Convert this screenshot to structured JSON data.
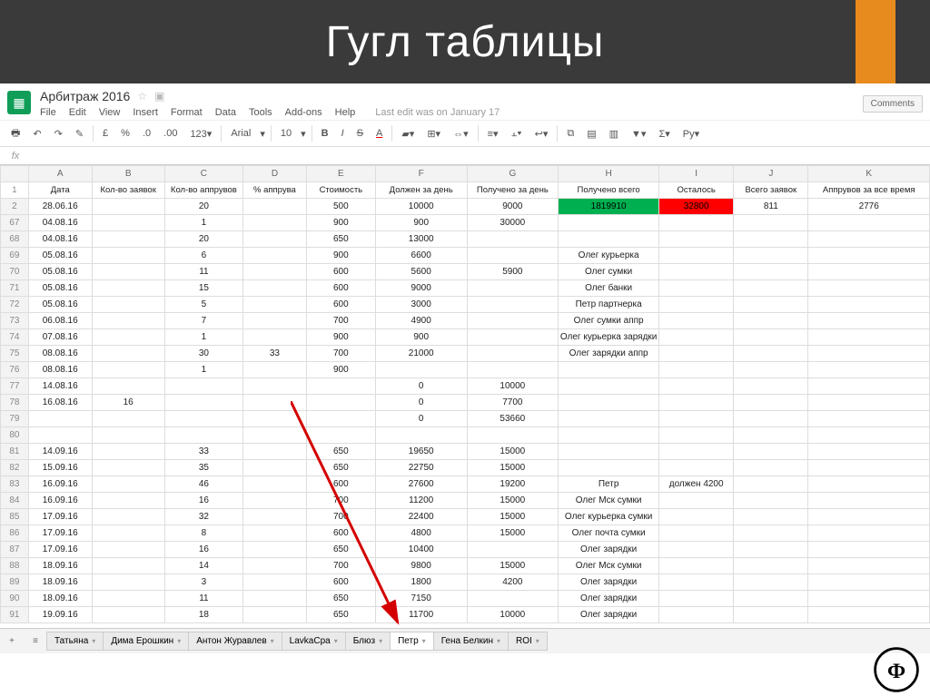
{
  "slide": {
    "title": "Гугл таблицы"
  },
  "doc": {
    "name": "Арбитраж 2016",
    "menu": [
      "File",
      "Edit",
      "View",
      "Insert",
      "Format",
      "Data",
      "Tools",
      "Add-ons",
      "Help"
    ],
    "last_edit": "Last edit was on January 17",
    "comments": "Comments"
  },
  "toolbar": {
    "font": "Arial",
    "fontsize": "10"
  },
  "columns": [
    "A",
    "B",
    "C",
    "D",
    "E",
    "F",
    "G",
    "H",
    "I",
    "J",
    "K"
  ],
  "header_labels": {
    "A": "Дата",
    "B": "Кол-во заявок",
    "C": "Кол-во аппрувов",
    "D": "% аппрува",
    "E": "Стоимость",
    "F": "Должен за день",
    "G": "Получено за день",
    "H": "Получено всего",
    "I": "Осталось",
    "J": "Всего заявок",
    "K": "Аппрувов за все время"
  },
  "rows": [
    {
      "n": "1",
      "header": true
    },
    {
      "n": "2",
      "A": "28.06.16",
      "C": "20",
      "E": "500",
      "F": "10000",
      "G": "9000",
      "H": "1819910",
      "H_bg": "green",
      "I": "32800",
      "I_bg": "red",
      "J": "811",
      "K": "2776"
    },
    {
      "n": "67",
      "A": "04.08.16",
      "C": "1",
      "E": "900",
      "F": "900",
      "G": "30000"
    },
    {
      "n": "68",
      "A": "04.08.16",
      "C": "20",
      "E": "650",
      "F": "13000"
    },
    {
      "n": "69",
      "A": "05.08.16",
      "C": "6",
      "E": "900",
      "F": "6600",
      "H": "Олег курьерка"
    },
    {
      "n": "70",
      "A": "05.08.16",
      "C": "11",
      "E": "600",
      "F": "5600",
      "G": "5900",
      "H": "Олег сумки"
    },
    {
      "n": "71",
      "A": "05.08.16",
      "C": "15",
      "E": "600",
      "F": "9000",
      "H": "Олег банки"
    },
    {
      "n": "72",
      "A": "05.08.16",
      "C": "5",
      "E": "600",
      "F": "3000",
      "H": "Петр партнерка"
    },
    {
      "n": "73",
      "A": "06.08.16",
      "C": "7",
      "E": "700",
      "F": "4900",
      "H": "Олег сумки аппр"
    },
    {
      "n": "74",
      "A": "07.08.16",
      "C": "1",
      "E": "900",
      "F": "900",
      "H": "Олег курьерка зарядки"
    },
    {
      "n": "75",
      "A": "08.08.16",
      "C": "30",
      "D": "33",
      "E": "700",
      "F": "21000",
      "H": "Олег зарядки аппр"
    },
    {
      "n": "76",
      "A": "08.08.16",
      "C": "1",
      "E": "900"
    },
    {
      "n": "77",
      "A": "14.08.16",
      "F": "0",
      "G": "10000"
    },
    {
      "n": "78",
      "A": "16.08.16",
      "B": "16",
      "F": "0",
      "G": "7700"
    },
    {
      "n": "79",
      "F": "0",
      "G": "53660"
    },
    {
      "n": "80"
    },
    {
      "n": "81",
      "A": "14.09.16",
      "C": "33",
      "E": "650",
      "F": "19650",
      "G": "15000"
    },
    {
      "n": "82",
      "A": "15.09.16",
      "C": "35",
      "E": "650",
      "F": "22750",
      "G": "15000"
    },
    {
      "n": "83",
      "A": "16.09.16",
      "C": "46",
      "E": "600",
      "F": "27600",
      "G": "19200",
      "H": "Петр",
      "I": "должен 4200"
    },
    {
      "n": "84",
      "A": "16.09.16",
      "C": "16",
      "E": "700",
      "F": "11200",
      "G": "15000",
      "H": "Олег Мск сумки"
    },
    {
      "n": "85",
      "A": "17.09.16",
      "C": "32",
      "E": "700",
      "F": "22400",
      "G": "15000",
      "H": "Олег   курьерка сумки"
    },
    {
      "n": "86",
      "A": "17.09.16",
      "C": "8",
      "E": "600",
      "F": "4800",
      "G": "15000",
      "H": "Олег почта сумки"
    },
    {
      "n": "87",
      "A": "17.09.16",
      "C": "16",
      "E": "650",
      "F": "10400",
      "H": "Олег зарядки"
    },
    {
      "n": "88",
      "A": "18.09.16",
      "C": "14",
      "E": "700",
      "F": "9800",
      "G": "15000",
      "H": "Олег Мск сумки"
    },
    {
      "n": "89",
      "A": "18.09.16",
      "C": "3",
      "E": "600",
      "F": "1800",
      "G": "4200",
      "H": "Олег зарядки"
    },
    {
      "n": "90",
      "A": "18.09.16",
      "C": "11",
      "E": "650",
      "F": "7150",
      "H": "Олег зарядки"
    },
    {
      "n": "91",
      "A": "19.09.16",
      "C": "18",
      "E": "650",
      "F": "11700",
      "G": "10000",
      "H": "Олег зарядки"
    }
  ],
  "tabs": {
    "list": [
      "Татьяна",
      "Дима Ерошкин",
      "Антон Журавлев",
      "LavkaCpa",
      "Блюз",
      "Петр",
      "Гена Белкин",
      "ROI"
    ],
    "active": "Петр"
  }
}
